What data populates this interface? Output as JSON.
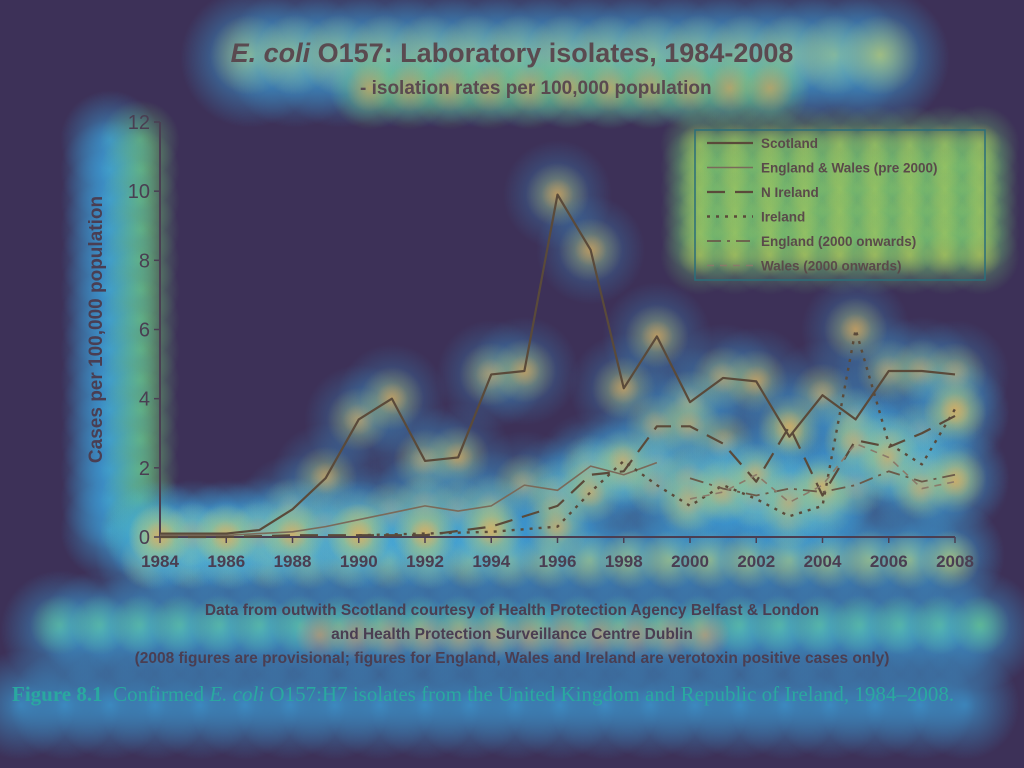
{
  "title": {
    "organism": "E. coli",
    "rest": " O157: Laboratory isolates, 1984-2008"
  },
  "subtitle": "- isolation rates per 100,000 population",
  "notes": {
    "line1": "Data from outwith Scotland courtesy of Health Protection Agency Belfast & London",
    "line2": "and Health Protection Surveillance Centre Dublin",
    "line3": "(2008 figures are provisional; figures for England, Wales and Ireland are verotoxin positive cases only)"
  },
  "caption": {
    "figure": "Figure 8.1",
    "before": "Confirmed ",
    "italic": "E. coli",
    "after": " O157:H7 isolates from the United Kingdom and Republic of Ireland, 1984–2008."
  },
  "chart_data": {
    "type": "line",
    "title": "E. coli O157: Laboratory isolates, 1984-2008",
    "subtitle": "- isolation rates per 100,000 population",
    "xlabel": "",
    "ylabel": "Cases per 100,000 population",
    "xlim": [
      1984,
      2008
    ],
    "ylim": [
      0,
      12
    ],
    "xticks": [
      1984,
      1986,
      1988,
      1990,
      1992,
      1994,
      1996,
      1998,
      2000,
      2002,
      2004,
      2006,
      2008
    ],
    "yticks": [
      0,
      2,
      4,
      6,
      8,
      10,
      12
    ],
    "grid": false,
    "legend": "top-right",
    "series": [
      {
        "name": "Scotland",
        "style": "solid",
        "color": "#5a4a3a",
        "x": [
          1984,
          1985,
          1986,
          1987,
          1988,
          1989,
          1990,
          1991,
          1992,
          1993,
          1994,
          1995,
          1996,
          1997,
          1998,
          1999,
          2000,
          2001,
          2002,
          2003,
          2004,
          2005,
          2006,
          2007,
          2008
        ],
        "y": [
          0.1,
          0.1,
          0.1,
          0.2,
          0.8,
          1.7,
          3.4,
          4.0,
          2.2,
          2.3,
          4.7,
          4.8,
          9.9,
          8.3,
          4.3,
          5.8,
          3.9,
          4.6,
          4.5,
          2.9,
          4.1,
          3.4,
          4.8,
          4.8,
          4.7
        ]
      },
      {
        "name": "England & Wales (pre 2000)",
        "style": "solid-thin",
        "color": "#7a6a5a",
        "x": [
          1984,
          1985,
          1986,
          1987,
          1988,
          1989,
          1990,
          1991,
          1992,
          1993,
          1994,
          1995,
          1996,
          1997,
          1998,
          1999
        ],
        "y": [
          0.05,
          0.05,
          0.05,
          0.1,
          0.15,
          0.3,
          0.5,
          0.7,
          0.9,
          0.75,
          0.9,
          1.5,
          1.35,
          2.05,
          1.8,
          2.15
        ]
      },
      {
        "name": "N Ireland",
        "style": "long-dash",
        "color": "#5a4a3a",
        "x": [
          1984,
          1986,
          1988,
          1990,
          1992,
          1994,
          1996,
          1997,
          1998,
          1999,
          2000,
          2001,
          2002,
          2003,
          2004,
          2005,
          2006,
          2007,
          2008
        ],
        "y": [
          0.0,
          0.0,
          0.05,
          0.05,
          0.05,
          0.3,
          0.9,
          1.8,
          1.9,
          3.2,
          3.2,
          2.7,
          1.6,
          3.2,
          1.2,
          2.8,
          2.6,
          3.0,
          3.5
        ]
      },
      {
        "name": "Ireland",
        "style": "dot",
        "color": "#5a4a3a",
        "x": [
          1990,
          1992,
          1994,
          1996,
          1997,
          1998,
          1999,
          2000,
          2001,
          2002,
          2003,
          2004,
          2005,
          2006,
          2007,
          2008
        ],
        "y": [
          0.05,
          0.1,
          0.15,
          0.3,
          1.3,
          2.2,
          1.5,
          0.9,
          1.5,
          1.1,
          0.6,
          0.9,
          6.0,
          2.7,
          2.1,
          3.7
        ]
      },
      {
        "name": "England (2000 onwards)",
        "style": "dash-dot",
        "color": "#6a5a4a",
        "x": [
          2000,
          2001,
          2002,
          2003,
          2004,
          2005,
          2006,
          2007,
          2008
        ],
        "y": [
          1.7,
          1.4,
          1.2,
          1.4,
          1.3,
          1.5,
          1.9,
          1.6,
          1.8
        ]
      },
      {
        "name": "Wales (2000 onwards)",
        "style": "short-dash",
        "color": "#8a7a6a",
        "x": [
          2000,
          2001,
          2002,
          2003,
          2004,
          2005,
          2006,
          2007,
          2008
        ],
        "y": [
          1.1,
          1.3,
          1.8,
          1.0,
          1.5,
          2.7,
          2.3,
          1.4,
          1.6
        ]
      }
    ]
  }
}
